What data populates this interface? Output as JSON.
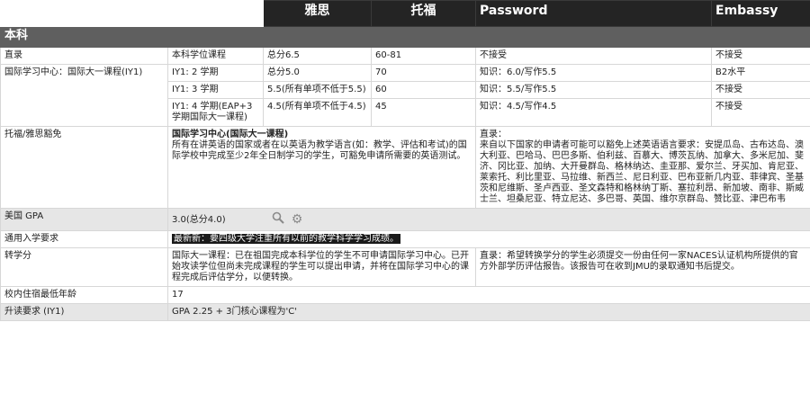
{
  "header": {
    "col_ielts": "雅思",
    "col_toefl": "托福",
    "col_password": "Password",
    "col_embassy": "Embassy"
  },
  "section_title": "本科",
  "rows": {
    "direct": {
      "label": "直录",
      "course": "本科学位课程",
      "ielts": "总分6.5",
      "toefl": "60-81",
      "password": "不接受",
      "embassy": "不接受"
    },
    "iy1_label": "国际学习中心：国际大一课程(IY1)",
    "iy1_2": {
      "course": "IY1: 2 学期",
      "ielts": "总分5.0",
      "toefl": "70",
      "password": "知识：6.0/写作5.5",
      "embassy": "B2水平"
    },
    "iy1_3": {
      "course": "IY1: 3 学期",
      "ielts": "5.5(所有单项不低于5.5)",
      "toefl": "60",
      "password": "知识：5.5/写作5.5",
      "embassy": "不接受"
    },
    "iy1_4": {
      "course": "IY1: 4 学期(EAP+3学期国际大一课程)",
      "ielts": "4.5(所有单项不低于4.5)",
      "toefl": "45",
      "password": "知识：4.5/写作4.5",
      "embassy": "不接受"
    },
    "waiver": {
      "label": "托福/雅思豁免",
      "left_title": "国际学习中心(国际大一课程)",
      "left_text": "所有在讲英语的国家或者在以英语为教学语言(如：教学、评估和考试)的国际学校中完成至少2年全日制学习的学生，可豁免申请所需要的英语测试。",
      "right_title": "直录：",
      "right_text": "来自以下国家的申请者可能可以豁免上述英语语言要求：安提瓜岛、古布达岛、澳大利亚、巴哈马、巴巴多斯、伯利兹、百慕大、博茨瓦纳、加拿大、多米尼加、斐济、冈比亚、加纳、大开曼群岛、格林纳达、圭亚那、爱尔兰、牙买加、肯尼亚、莱索托、利比里亚、马拉维、新西兰、尼日利亚、巴布亚新几内亚、菲律宾、圣基茨和尼维斯、圣卢西亚、圣文森特和格林纳丁斯、塞拉利昂、新加坡、南非、斯威士兰、坦桑尼亚、特立尼达、多巴哥、英国、维尔京群岛、赞比亚、津巴布韦"
    },
    "gpa": {
      "label": "美国 GPA",
      "value": "3.0(总分4.0)",
      "search_icon": "search-icon",
      "settings_icon": "gear-icon"
    },
    "general": {
      "label": "通用入学要求",
      "value": "最新新：要四级大学注重所有以前的教学科学学习成绩。"
    },
    "transfer": {
      "label": "转学分",
      "left_text": "国际大一课程：已在祖国完成本科学位的学生不可申请国际学习中心。已开始攻读学位但尚未完成课程的学生可以提出申请，并将在国际学习中心的课程完成后评估学分，以便转换。",
      "right_text": "直录：希望转换学分的学生必须提交一份由任何一家NACES认证机构所提供的官方外部学历评估报告。该报告可在收到JMU的录取通知书后提交。"
    },
    "min_age": {
      "label": "校内住宿最低年龄",
      "value": "17"
    },
    "progression": {
      "label": "升读要求 (IY1)",
      "value": "GPA 2.25 + 3门核心课程为'C'"
    }
  }
}
